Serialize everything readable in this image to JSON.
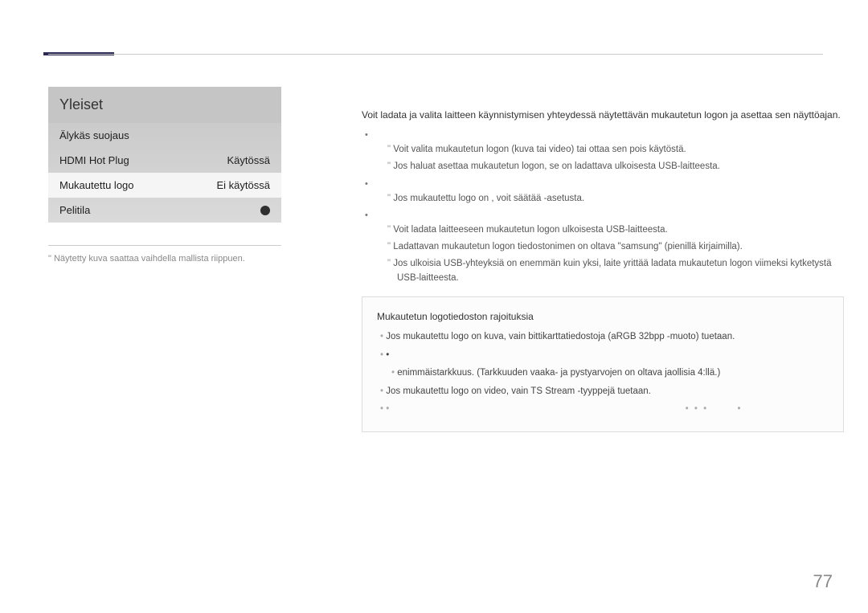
{
  "panel": {
    "title": "Yleiset",
    "row0": "Älykäs suojaus",
    "row1_label": "HDMI Hot Plug",
    "row1_value": "Käytössä",
    "row2_label": "Mukautettu logo",
    "row2_value": "Ei käytössä",
    "row3_label": "Pelitila"
  },
  "caption": "Näytetty kuva saattaa vaihdella mallista riippuen.",
  "intro": "Voit ladata ja valita laitteen käynnistymisen yhteydessä näytettävän mukautetun logon ja asettaa sen näyttöajan.",
  "b1a": "Voit valita mukautetun logon (kuva tai video) tai ottaa sen pois käytöstä.",
  "b1b": "Jos haluat asettaa mukautetun logon, se on ladattava ulkoisesta USB-laitteesta.",
  "b2a": "Jos mukautettu logo on         , voit säätää  -asetusta.",
  "b3a": "Voit ladata laitteeseen mukautetun logon ulkoisesta USB-laitteesta.",
  "b3b": "Ladattavan mukautetun logon tiedostonimen on oltava \"samsung\" (pienillä kirjaimilla).",
  "b3c": "Jos ulkoisia USB-yhteyksiä on enemmän kuin yksi, laite yrittää ladata mukautetun logon viimeksi kytketystä USB-laitteesta.",
  "box": {
    "title": "Mukautetun logotiedoston rajoituksia",
    "i1": "Jos mukautettu logo on kuva, vain bittikarttatiedostoja (aRGB 32bpp -muoto) tuetaan.",
    "i2": "enimmäistarkkuus. (Tarkkuuden vaaka- ja pystyarvojen on oltava jaollisia 4:llä.)",
    "i3": "Jos mukautettu logo on video, vain TS Stream -tyyppejä tuetaan."
  },
  "pagenum": "77"
}
